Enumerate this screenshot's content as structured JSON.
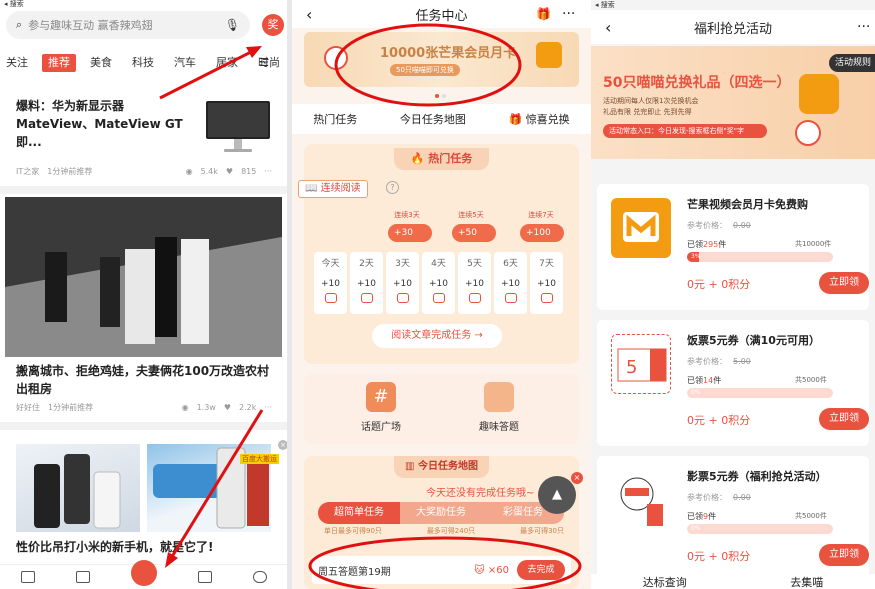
{
  "panel1": {
    "status": "◂ 搜索",
    "search_placeholder": "参与趣味互动 赢香辣鸡翅",
    "reward_badge": "奖",
    "tabs": [
      "关注",
      "推荐",
      "美食",
      "科技",
      "汽车",
      "居家",
      "时尚"
    ],
    "active_tab": "推荐",
    "news": [
      {
        "title": "爆料：华为新显示器 MateView、MateView GT 即...",
        "source": "IT之家",
        "time": "1分钟前推荐",
        "views": "5.4k",
        "likes": "815"
      },
      {
        "title": "搬离城市、拒绝鸡娃，夫妻俩花100万改造农村出租房",
        "source": "好好住",
        "time": "1分钟前推荐",
        "views": "1.3w",
        "likes": "2.2k"
      },
      {
        "title": "性价比吊打小米的新手机，就是它了!",
        "ad_tag": "百度大搬运"
      }
    ],
    "nav": [
      "首页",
      "视频",
      "任务中心",
      "商城",
      "我的"
    ]
  },
  "panel2": {
    "title": "任务中心",
    "banner_main": "10000张芒果会员月卡",
    "banner_sub": "50只喵喵即可兑换",
    "nav": [
      "热门任务",
      "今日任务地图",
      "惊喜兑换"
    ],
    "hot_title": "热门任务",
    "continuous": "连续阅读",
    "streaks": [
      {
        "label": "连续3天",
        "bonus": "+30"
      },
      {
        "label": "连续5天",
        "bonus": "+50"
      },
      {
        "label": "连续7天",
        "bonus": "+100"
      }
    ],
    "days": [
      "今天",
      "2天",
      "3天",
      "4天",
      "5天",
      "6天",
      "7天"
    ],
    "day_points": "+10",
    "read_btn": "阅读文章完成任务 →",
    "topic1": "话题广场",
    "topic2": "趣味答题",
    "map_title": "今日任务地图",
    "map_note": "今天还没有完成任务哦~",
    "task_tabs": [
      "超简单任务",
      "大奖励任务",
      "彩蛋任务"
    ],
    "sub_left": "单日最多可得90只",
    "sub_mid": "最多可得240只",
    "sub_right": "最多可得30只",
    "issue": "周五答题第19期",
    "issue_count": "×60",
    "issue_btn": "去完成"
  },
  "panel3": {
    "status": "◂ 搜索",
    "title": "福利抢兑活动",
    "rules": "活动规则",
    "banner_title": "50只喵喵兑换礼品（四选一）",
    "banner_line1": "活动期间每人仅限1次兑换机会",
    "banner_line2": "礼品有限 兑完即止 先到先得",
    "banner_entry": "活动常态入口：今日发现-搜索框右侧\"奖\"字",
    "prizes": [
      {
        "name": "芒果视频会员月卡免费购",
        "ref": "参考价格：",
        "ref_price": "0.00",
        "got_label": "已领",
        "got": "295",
        "unit": "件",
        "total": "共10000件",
        "pct": "3%",
        "cost": "0元 + 0积分",
        "btn": "立即领"
      },
      {
        "name": "饭票5元券（满10元可用）",
        "ref": "参考价格：",
        "ref_price": "5.00",
        "got_label": "已领",
        "got": "14",
        "unit": "件",
        "total": "共5000件",
        "pct": "0%",
        "cost": "0元 + 0积分",
        "btn": "立即领"
      },
      {
        "name": "影票5元券（福利抢兑活动）",
        "ref": "参考价格：",
        "ref_price": "0.00",
        "got_label": "已领",
        "got": "9",
        "unit": "件",
        "total": "共5000件",
        "pct": "0%",
        "cost": "0元 + 0积分",
        "btn": "立即领"
      }
    ],
    "bottom": [
      "达标查询",
      "去集喵"
    ]
  },
  "colors": {
    "accent": "#e8523f",
    "annotation": "#e01010"
  }
}
